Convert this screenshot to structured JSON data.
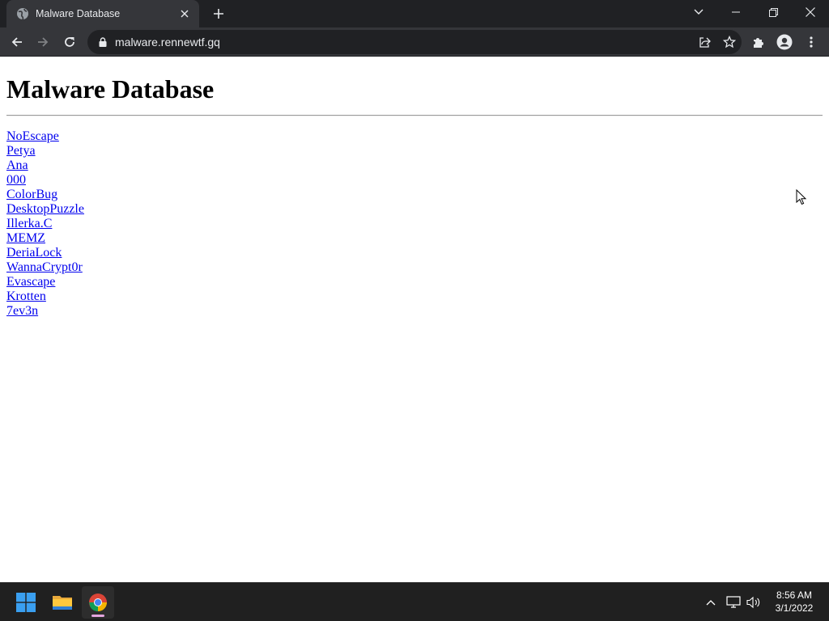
{
  "browser": {
    "tab": {
      "title": "Malware Database",
      "favicon": "globe-icon",
      "close_icon": "close-icon"
    },
    "new_tab_icon": "plus-icon",
    "window_controls": [
      "chevron-down-icon",
      "minimize-icon",
      "restore-icon",
      "close-icon"
    ],
    "toolbar": {
      "back_icon": "arrow-left-icon",
      "forward_icon": "arrow-right-icon",
      "reload_icon": "reload-icon",
      "url": "malware.rennewtf.gq",
      "lock_icon": "lock-icon",
      "share_icon": "share-icon",
      "bookmark_icon": "star-icon",
      "extensions_icon": "puzzle-icon",
      "profile_icon": "profile-icon",
      "menu_icon": "kebab-menu-icon"
    }
  },
  "page": {
    "heading": "Malware Database",
    "links": [
      "NoEscape",
      "Petya",
      "Ana",
      "000",
      "ColorBug",
      "DesktopPuzzle",
      "Illerka.C",
      "MEMZ",
      "DeriaLock",
      "WannaCrypt0r",
      "Evascape",
      "Krotten",
      "7ev3n"
    ]
  },
  "taskbar": {
    "apps": [
      "windows-start-icon",
      "file-explorer-icon",
      "chrome-icon"
    ],
    "active_app": "chrome-icon",
    "tray": [
      "chevron-up-icon",
      "network-icon",
      "volume-icon"
    ],
    "time": "8:56 AM",
    "date": "3/1/2022"
  },
  "colors": {
    "titlebar": "#202124",
    "toolbar": "#35363a",
    "link": "#0000ee",
    "taskbar": "#202020"
  }
}
